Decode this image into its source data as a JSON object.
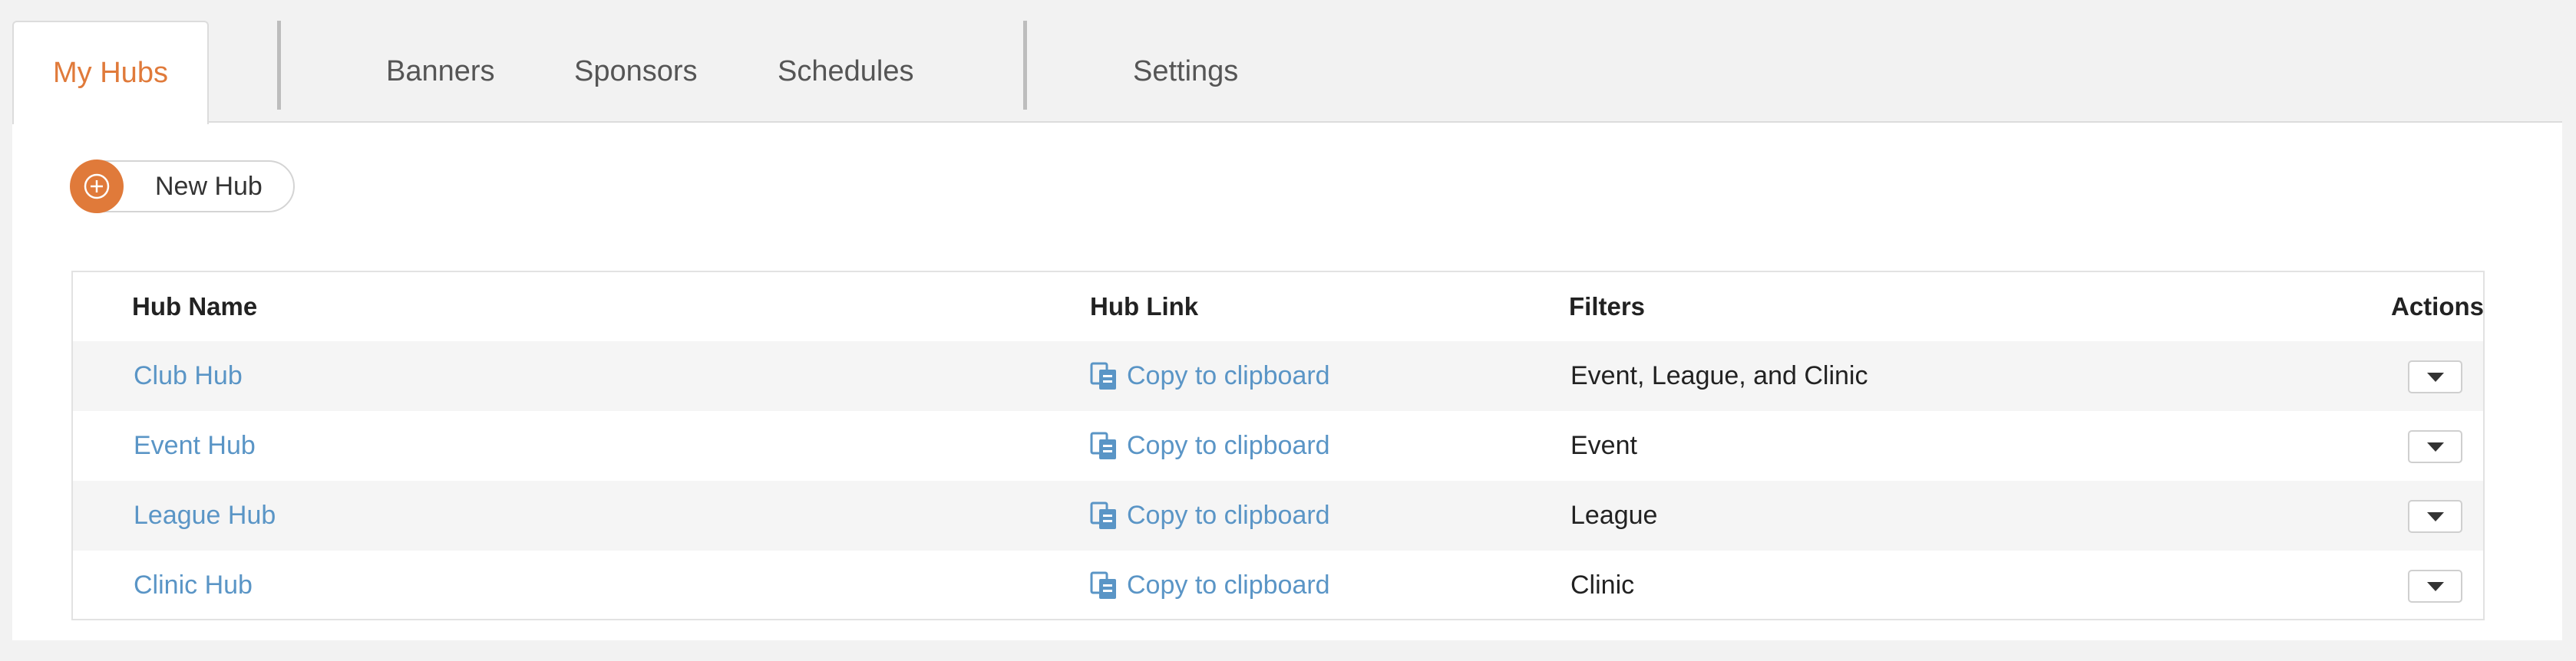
{
  "tabs": {
    "active": "My Hubs",
    "items": [
      "Banners",
      "Sponsors",
      "Schedules",
      "Settings"
    ]
  },
  "toolbar": {
    "new_hub_label": "New Hub"
  },
  "table": {
    "headers": {
      "hub_name": "Hub Name",
      "hub_link": "Hub Link",
      "filters": "Filters",
      "actions": "Actions"
    },
    "rows": [
      {
        "name": "Club Hub",
        "link": "Copy to clipboard",
        "filters": "Event, League, and Clinic"
      },
      {
        "name": "Event Hub",
        "link": "Copy to clipboard",
        "filters": "Event"
      },
      {
        "name": "League Hub",
        "link": "Copy to clipboard",
        "filters": "League"
      },
      {
        "name": "Clinic Hub",
        "link": "Copy to clipboard",
        "filters": "Clinic"
      }
    ]
  },
  "icons": {
    "plus": "plus-circle-icon",
    "copy": "clipboard-copy-icon",
    "dropdown": "caret-down-icon"
  },
  "colors": {
    "accent": "#e07a3a",
    "link": "#5a95c6",
    "background": "#f2f2f2",
    "row_stripe": "#f5f5f5"
  }
}
